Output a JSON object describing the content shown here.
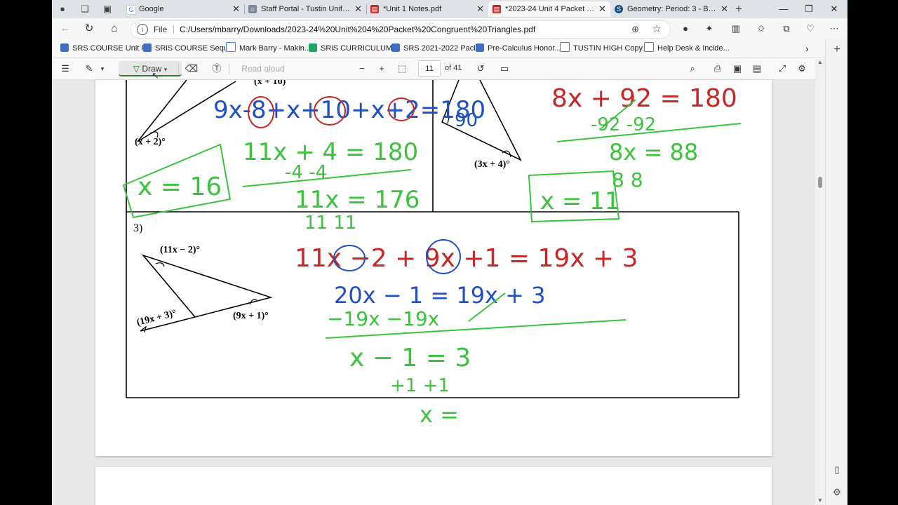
{
  "tabs": [
    {
      "title": "Google",
      "favicon": "google-icon",
      "color": "#4285f4"
    },
    {
      "title": "Staff Portal - Tustin Unified Sc",
      "favicon": "portal-icon",
      "color": "#7a8a9a"
    },
    {
      "title": "*Unit 1 Notes.pdf",
      "favicon": "pdf-icon",
      "color": "#c62828"
    },
    {
      "title": "*2023-24 Unit 4 Packet Cong",
      "favicon": "pdf-icon",
      "color": "#c62828",
      "active": true
    },
    {
      "title": "Geometry: Period: 3 - Barry | C",
      "favicon": "schoology-icon",
      "color": "#1a4d80"
    }
  ],
  "new_tab": "+",
  "address": {
    "scheme_label": "File",
    "url": "C:/Users/mbarry/Downloads/2023-24%20Unit%204%20Packet%20Congruent%20Triangles.pdf"
  },
  "favorites": [
    {
      "label": "SRS COURSE Unit P...",
      "color": "#3f6fc8"
    },
    {
      "label": "SRiS COURSE Sequ...",
      "color": "#3f6fc8"
    },
    {
      "label": "Mark Barry - Makin...",
      "color": "#4285f4"
    },
    {
      "label": "SRiS CURRICULUM...",
      "color": "#1fa463"
    },
    {
      "label": "SRS 2021-2022 Paci...",
      "color": "#3f6fc8"
    },
    {
      "label": "Pre-Calculus Honor...",
      "color": "#3f6fc8"
    },
    {
      "label": "TUSTIN HIGH Copy...",
      "color": "#777777"
    },
    {
      "label": "Help Desk & Incide...",
      "color": "#777777"
    }
  ],
  "pdf_toolbar": {
    "draw_label": "Draw",
    "read_aloud_label": "Read aloud",
    "page_number": "11",
    "page_total": "of 41"
  },
  "problem3": {
    "number": "3)"
  },
  "labels": {
    "top_left_angle": "(x + 2)°",
    "top_left_partial": "(x + 10)",
    "top_right_angle": "(3x + 4)°",
    "p3_top": "(11x − 2)°",
    "p3_left": "(19x + 3)°",
    "p3_right": "(9x + 1)°"
  },
  "handwriting": {
    "tl_blue_equation": "9x-8+x+10+x+2=180",
    "tl_green_1": "11x + 4 = 180",
    "tl_green_2": "-4      -4",
    "tl_green_3": "11x = 176",
    "tl_green_4": "11      11",
    "tl_answer": "x = 16",
    "tr_blue_90": "90",
    "tr_red_1": "8x + 92 = 180",
    "tr_green_2": "-92     -92",
    "tr_green_3": "8x  =  88",
    "tr_green_4": "8       8",
    "tr_answer": "x = 11",
    "p3_red": "11x −2 + 9x +1 = 19x + 3",
    "p3_blue": "20x − 1 = 19x + 3",
    "p3_green_sub": "−19x            −19x",
    "p3_green_1": "x − 1 = 3",
    "p3_green_add": "+1             +1",
    "p3_green_ans": "x ="
  },
  "colors": {
    "red_ink": "#c62828",
    "blue_ink": "#1f4fc4",
    "green_ink": "#3cc23c"
  }
}
